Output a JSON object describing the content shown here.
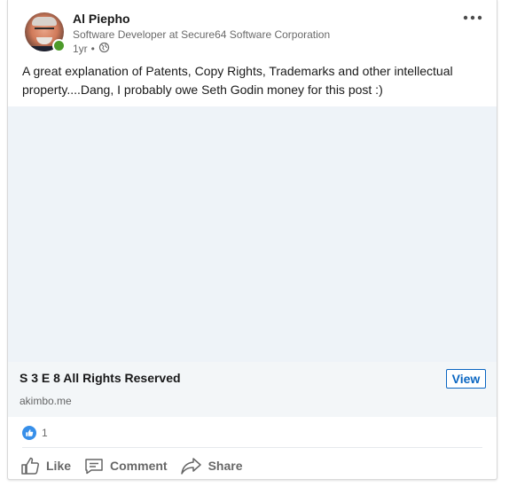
{
  "post": {
    "author": {
      "name": "Al Piepho",
      "headline": "Software Developer at Secure64 Software Corporation",
      "age": "1yr",
      "separator": "•",
      "visibility_icon": "globe-icon",
      "presence": "online"
    },
    "commentary": "A great explanation of Patents, Copy Rights, Trademarks and other intellectual property....Dang, I probably owe Seth Godin money for this post :)",
    "article": {
      "title": "S 3 E 8 All Rights Reserved",
      "source": "akimbo.me",
      "view_label": "View"
    },
    "reactions": {
      "icon": "thumbs-up-icon",
      "count": "1"
    },
    "actions": {
      "like": "Like",
      "comment": "Comment",
      "share": "Share"
    }
  },
  "colors": {
    "brand_blue": "#0a66c2",
    "presence_green": "#4c9a2a",
    "media_placeholder": "#eef3f8"
  }
}
